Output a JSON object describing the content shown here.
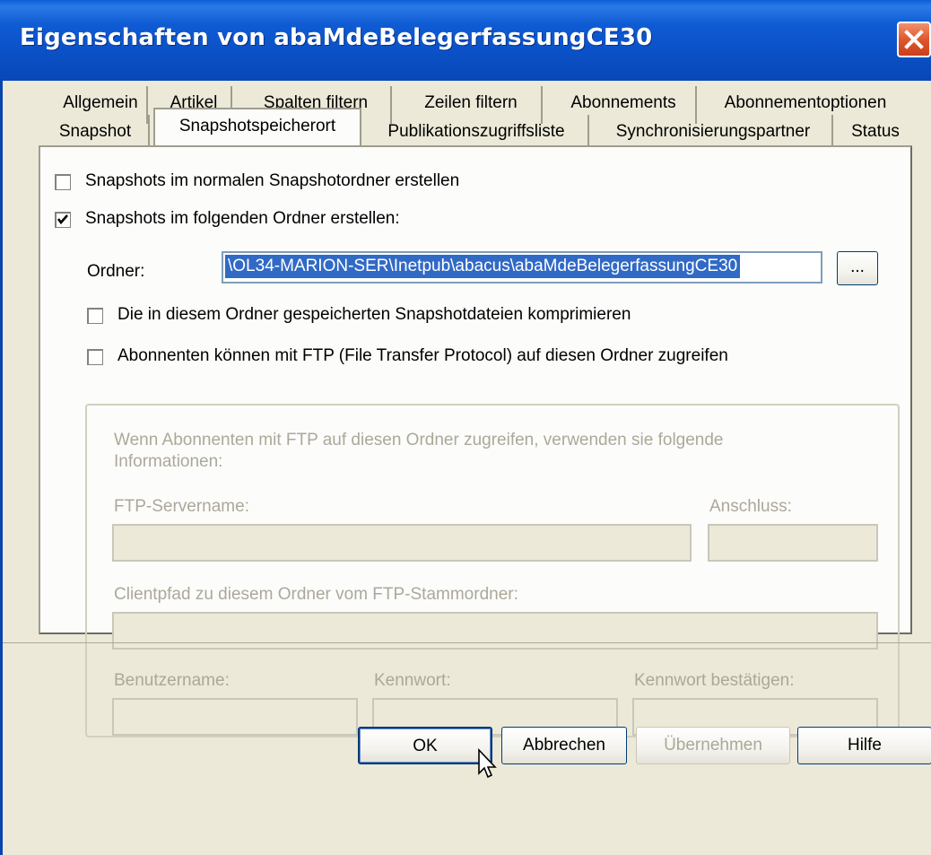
{
  "window": {
    "title": "Eigenschaften von abaMdeBelegerfassungCE30"
  },
  "tabs_row1": [
    {
      "label": "Allgemein"
    },
    {
      "label": "Artikel"
    },
    {
      "label": "Spalten filtern"
    },
    {
      "label": "Zeilen filtern"
    },
    {
      "label": "Abonnements"
    },
    {
      "label": "Abonnementoptionen"
    }
  ],
  "tabs_row2": [
    {
      "label": "Snapshot"
    },
    {
      "label": "Snapshotspeicherort",
      "active": true
    },
    {
      "label": "Publikationszugriffsliste"
    },
    {
      "label": "Synchronisierungspartner"
    },
    {
      "label": "Status"
    }
  ],
  "options": {
    "normal_folder": {
      "label": "Snapshots im normalen Snapshotordner erstellen",
      "checked": false
    },
    "following_folder": {
      "label": "Snapshots im folgenden Ordner erstellen:",
      "checked": true
    },
    "folder_label": "Ordner:",
    "folder_value": "\\OL34-MARION-SER\\Inetpub\\abacus\\abaMdeBelegerfassungCE30",
    "browse_label": "...",
    "compress": {
      "label": "Die in diesem Ordner gespeicherten Snapshotdateien komprimieren",
      "checked": false
    },
    "ftp": {
      "label": "Abonnenten können mit FTP (File Transfer Protocol) auf diesen Ordner zugreifen",
      "checked": false
    }
  },
  "ftp_group": {
    "info_line1": "Wenn Abonnenten mit FTP auf diesen Ordner zugreifen, verwenden sie folgende",
    "info_line2": "Informationen:",
    "server_label": "FTP-Servername:",
    "port_label": "Anschluss:",
    "client_path_label": "Clientpfad zu diesem Ordner vom FTP-Stammordner:",
    "user_label": "Benutzername:",
    "password_label": "Kennwort:",
    "confirm_label": "Kennwort bestätigen:"
  },
  "buttons": {
    "ok": "OK",
    "cancel": "Abbrechen",
    "apply": "Übernehmen",
    "help": "Hilfe"
  }
}
